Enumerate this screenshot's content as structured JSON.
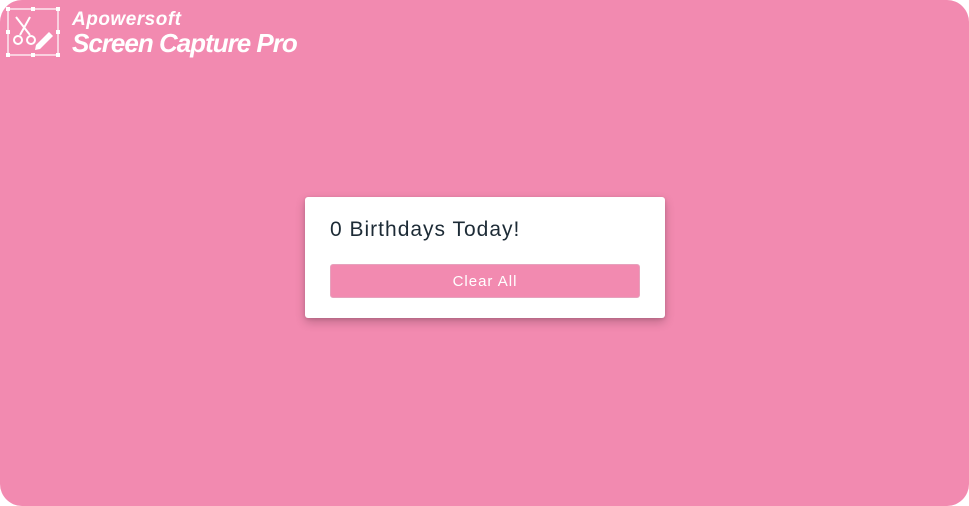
{
  "watermark": {
    "line1": "Apowersoft",
    "line2": "Screen Capture Pro",
    "icon": "scissors-pencil-icon"
  },
  "card": {
    "title": "0 Birthdays Today!",
    "clear_button_label": "Clear All"
  },
  "colors": {
    "background": "#f28ab0",
    "card": "#ffffff",
    "title_text": "#1d2b36",
    "button": "#f28ab0",
    "button_text": "#ffffff"
  }
}
